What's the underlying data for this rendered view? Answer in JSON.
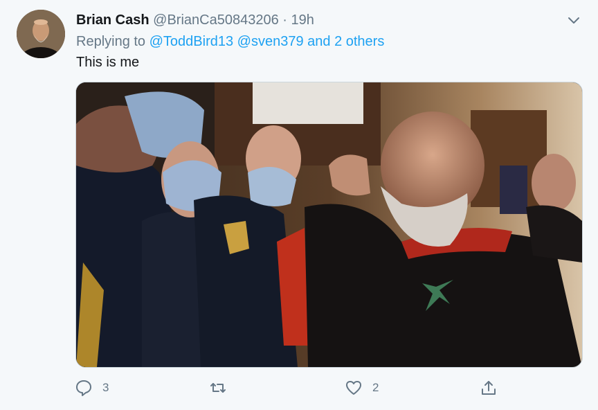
{
  "tweet": {
    "name": "Brian Cash",
    "handle": "@BrianCa50843206",
    "separator": "·",
    "time": "19h",
    "replying_prefix": "Replying to",
    "replying_links": "@ToddBird13 @sven379 and 2 others",
    "text": "This is me",
    "avatar_icon": "user-avatar",
    "menu_icon": "chevron-down-icon",
    "image_description_icon": "photo"
  },
  "actions": {
    "reply_count": "3",
    "retweet_count": "",
    "like_count": "2",
    "share_count": ""
  },
  "colors": {
    "accent": "#1da1f2",
    "secondary_text": "#657786",
    "background": "#f5f8fa"
  }
}
